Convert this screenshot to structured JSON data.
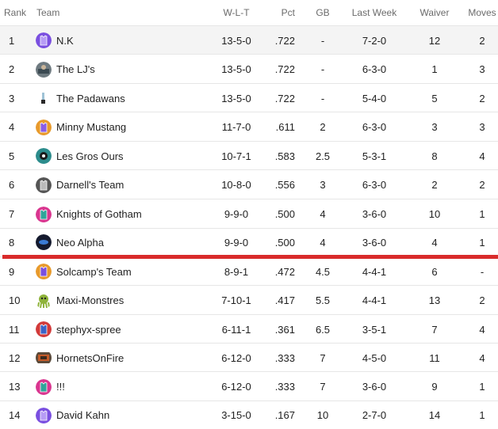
{
  "columns": {
    "rank": "Rank",
    "team": "Team",
    "wlt": "W-L-T",
    "pct": "Pct",
    "gb": "GB",
    "last_week": "Last Week",
    "waiver": "Waiver",
    "moves": "Moves"
  },
  "colors": {
    "playoff_line": "#d92b2b",
    "highlight_row": "#f4f4f4",
    "purple": "#7a4fe0",
    "orange": "#e89a2c",
    "pink": "#d9358f",
    "teal": "#2c8c8c",
    "dark": "#333333"
  },
  "rows": [
    {
      "rank": "1",
      "team": "N.K",
      "wlt": "13-5-0",
      "pct": ".722",
      "gb": "-",
      "last_week": "7-2-0",
      "waiver": "12",
      "moves": "2",
      "avatar": "purple-jersey-icon"
    },
    {
      "rank": "2",
      "team": "The LJ's",
      "wlt": "13-5-0",
      "pct": ".722",
      "gb": "-",
      "last_week": "6-3-0",
      "waiver": "1",
      "moves": "3",
      "avatar": "photo-avatar-icon"
    },
    {
      "rank": "3",
      "team": "The Padawans",
      "wlt": "13-5-0",
      "pct": ".722",
      "gb": "-",
      "last_week": "5-4-0",
      "waiver": "5",
      "moves": "2",
      "avatar": "lightsaber-avatar-icon"
    },
    {
      "rank": "4",
      "team": "Minny Mustang",
      "wlt": "11-7-0",
      "pct": ".611",
      "gb": "2",
      "last_week": "6-3-0",
      "waiver": "3",
      "moves": "3",
      "avatar": "orange-jersey-icon"
    },
    {
      "rank": "5",
      "team": "Les Gros Ours",
      "wlt": "10-7-1",
      "pct": ".583",
      "gb": "2.5",
      "last_week": "5-3-1",
      "waiver": "8",
      "moves": "4",
      "avatar": "teal-logo-icon"
    },
    {
      "rank": "6",
      "team": "Darnell's Team",
      "wlt": "10-8-0",
      "pct": ".556",
      "gb": "3",
      "last_week": "6-3-0",
      "waiver": "2",
      "moves": "2",
      "avatar": "gray-jersey-icon"
    },
    {
      "rank": "7",
      "team": "Knights of Gotham",
      "wlt": "9-9-0",
      "pct": ".500",
      "gb": "4",
      "last_week": "3-6-0",
      "waiver": "10",
      "moves": "1",
      "avatar": "pink-teal-jersey-icon"
    },
    {
      "rank": "8",
      "team": "Neo Alpha",
      "wlt": "9-9-0",
      "pct": ".500",
      "gb": "4",
      "last_week": "3-6-0",
      "waiver": "4",
      "moves": "1",
      "avatar": "dark-logo-icon"
    },
    {
      "rank": "9",
      "team": "Solcamp's Team",
      "wlt": "8-9-1",
      "pct": ".472",
      "gb": "4.5",
      "last_week": "4-4-1",
      "waiver": "6",
      "moves": "-",
      "avatar": "orange-purple-jersey-icon"
    },
    {
      "rank": "10",
      "team": "Maxi-Monstres",
      "wlt": "7-10-1",
      "pct": ".417",
      "gb": "5.5",
      "last_week": "4-4-1",
      "waiver": "13",
      "moves": "2",
      "avatar": "octopus-icon"
    },
    {
      "rank": "11",
      "team": "stephyx-spree",
      "wlt": "6-11-1",
      "pct": ".361",
      "gb": "6.5",
      "last_week": "3-5-1",
      "waiver": "7",
      "moves": "4",
      "avatar": "red-blue-jersey-icon"
    },
    {
      "rank": "12",
      "team": "HornetsOnFire",
      "wlt": "6-12-0",
      "pct": ".333",
      "gb": "7",
      "last_week": "4-5-0",
      "waiver": "11",
      "moves": "4",
      "avatar": "hornets-logo-icon"
    },
    {
      "rank": "13",
      "team": "!!!",
      "wlt": "6-12-0",
      "pct": ".333",
      "gb": "7",
      "last_week": "3-6-0",
      "waiver": "9",
      "moves": "1",
      "avatar": "pink-teal-jersey-icon"
    },
    {
      "rank": "14",
      "team": "David Kahn",
      "wlt": "3-15-0",
      "pct": ".167",
      "gb": "10",
      "last_week": "2-7-0",
      "waiver": "14",
      "moves": "1",
      "avatar": "purple-jersey-icon"
    }
  ]
}
